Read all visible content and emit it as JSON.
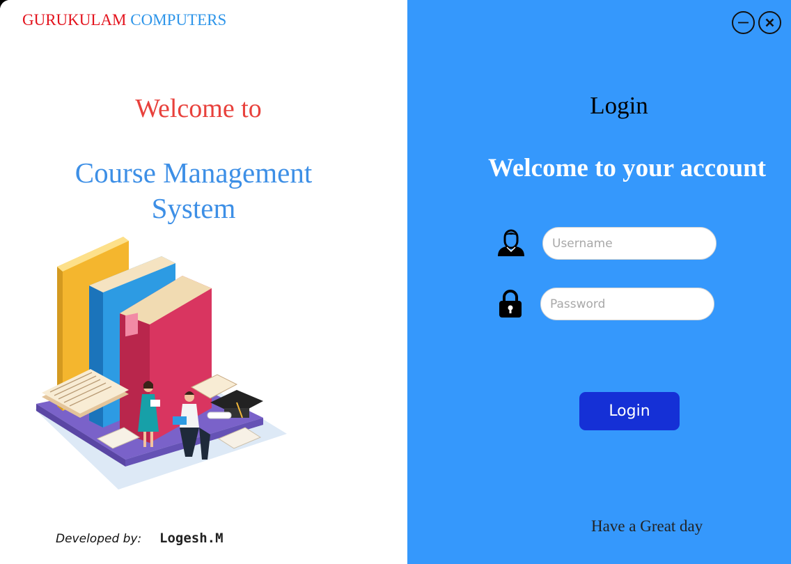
{
  "left_panel": {
    "brand_part1": "GURUKULAM",
    "brand_part2": "COMPUTERS",
    "welcome_to": "Welcome to",
    "title_line1": "Course Management",
    "title_line2": "System",
    "illustration": "books-students-illustration",
    "developed_by_label": "Developed by:",
    "developer_name": "Logesh.M"
  },
  "right_panel": {
    "window_controls": {
      "minimize": "minimize-icon",
      "close": "close-icon"
    },
    "login_heading": "Login",
    "welcome_message": "Welcome to your account",
    "username": {
      "icon": "user-icon",
      "placeholder": "Username",
      "value": ""
    },
    "password": {
      "icon": "lock-icon",
      "placeholder": "Password",
      "value": ""
    },
    "login_button": "Login",
    "footer": "Have a Great day"
  },
  "colors": {
    "brand_red": "#e3121c",
    "brand_blue": "#2e95e9",
    "right_panel_bg": "#3598fc",
    "login_button_bg": "#1530d6"
  }
}
